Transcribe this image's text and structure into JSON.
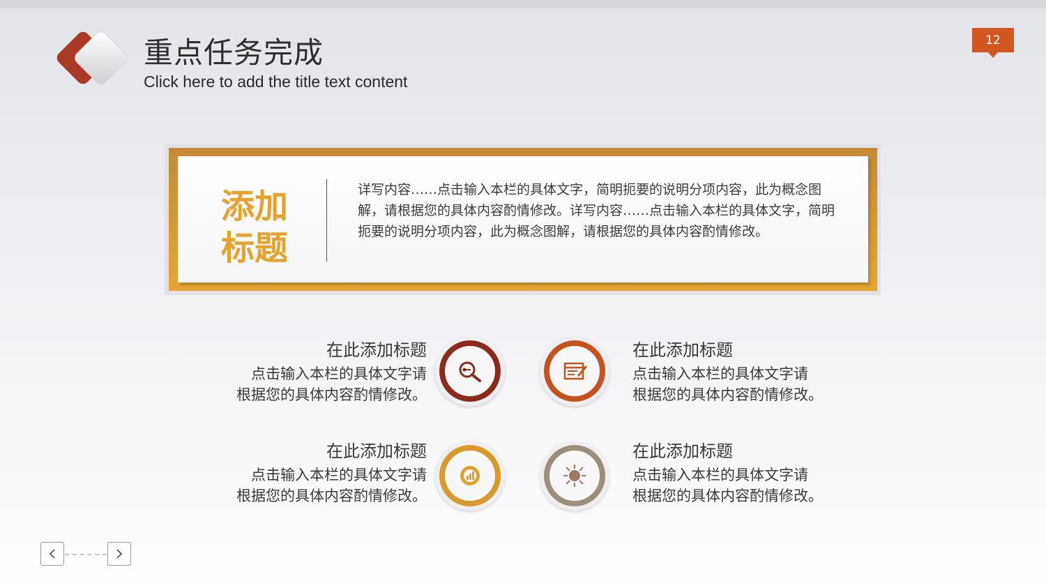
{
  "header": {
    "title": "重点任务完成",
    "subtitle": "Click here to add the title text content",
    "page_number": "12"
  },
  "feature_card": {
    "heading_line1": "添加",
    "heading_line2": "标题",
    "body": "详写内容……点击输入本栏的具体文字，简明扼要的说明分项内容，此为概念图解，请根据您的具体内容酌情修改。详写内容……点击输入本栏的具体文字，简明扼要的说明分项内容，此为概念图解，请根据您的具体内容酌情修改。"
  },
  "items": [
    {
      "title": "在此添加标题",
      "line1": "点击输入本栏的具体文字请",
      "line2": "根据您的具体内容酌情修改。",
      "icon": "key-search-icon",
      "color": "#8b2a1d"
    },
    {
      "title": "在此添加标题",
      "line1": "点击输入本栏的具体文字请",
      "line2": "根据您的具体内容酌情修改。",
      "icon": "browser-edit-icon",
      "color": "#c4531e"
    },
    {
      "title": "在此添加标题",
      "line1": "点击输入本栏的具体文字请",
      "line2": "根据您的具体内容酌情修改。",
      "icon": "chart-circle-icon",
      "color": "#d99a2b"
    },
    {
      "title": "在此添加标题",
      "line1": "点击输入本栏的具体文字请",
      "line2": "根据您的具体内容酌情修改。",
      "icon": "globe-network-icon",
      "color": "#9c8e7a"
    }
  ],
  "colors": {
    "accent_orange": "#d2561f",
    "gold": "#e5a32e",
    "dark_red": "#8b2a1d"
  }
}
